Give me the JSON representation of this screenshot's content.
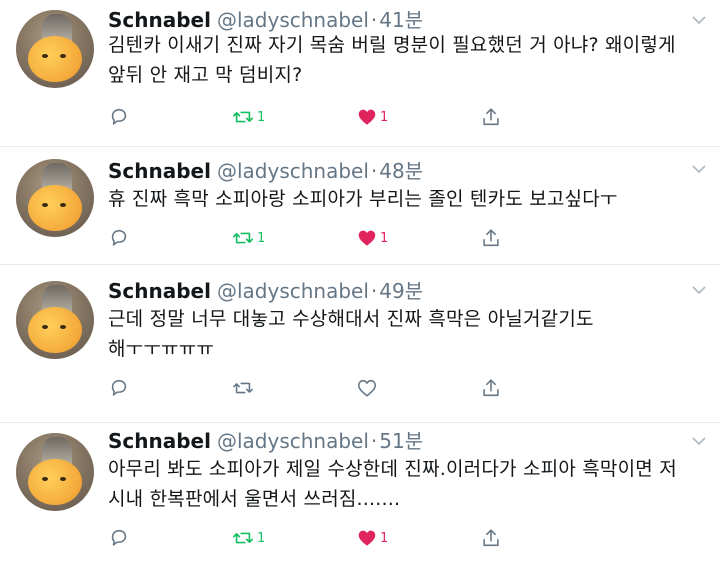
{
  "tweets": [
    {
      "name": "Schnabel",
      "handle": "@ladyschnabel",
      "separator": "·",
      "time": "41분",
      "text_lines": [
        "김텐카 이새기 진짜 자기 목숨 버릴 명분이 필요했던 거 아냐? 왜이렇게",
        "앞뒤 안 재고 막 덤비지?"
      ],
      "retweet_count": "1",
      "like_count": "1",
      "retweeted": true,
      "liked": true
    },
    {
      "name": "Schnabel",
      "handle": "@ladyschnabel",
      "separator": "·",
      "time": "48분",
      "text_lines": [
        "휴 진짜 흑막 소피아랑 소피아가 부리는 졸인 텐카도 보고싶다ㅜ"
      ],
      "retweet_count": "1",
      "like_count": "1",
      "retweeted": true,
      "liked": true
    },
    {
      "name": "Schnabel",
      "handle": "@ladyschnabel",
      "separator": "·",
      "time": "49분",
      "text_lines": [
        "근데 정말 너무 대놓고 수상해대서 진짜 흑막은 아닐거같기도",
        "해ㅜㅜㅠㅠㅠ"
      ],
      "retweet_count": "",
      "like_count": "",
      "retweeted": false,
      "liked": false
    },
    {
      "name": "Schnabel",
      "handle": "@ladyschnabel",
      "separator": "·",
      "time": "51분",
      "text_lines": [
        "아무리 봐도 소피아가 제일 수상한데 진짜.이러다가 소피아 흑막이면 저",
        "시내 한복판에서 울면서 쓰러짐......."
      ],
      "retweet_count": "1",
      "like_count": "1",
      "retweeted": true,
      "liked": true
    }
  ],
  "colors": {
    "text": "#14171a",
    "muted": "#657786",
    "icon": "#657786",
    "retweet_active": "#17bf63",
    "like_active": "#e0245e",
    "divider": "#e6ecf0"
  },
  "icons": [
    "chevron-down-icon",
    "reply-icon",
    "retweet-icon",
    "heart-icon",
    "share-icon"
  ]
}
